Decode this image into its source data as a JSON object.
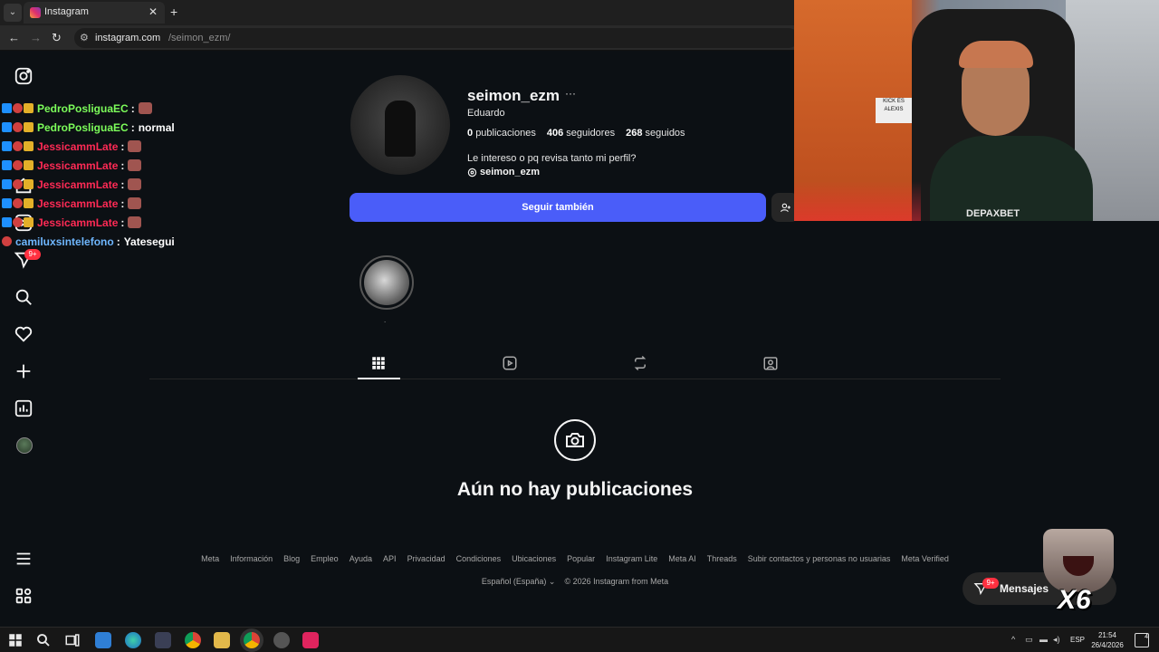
{
  "browser": {
    "tab_title": "Instagram",
    "tab_close": "✕",
    "new_tab": "+",
    "url_host": "instagram.com",
    "url_path": "/seimon_ezm/"
  },
  "chat": [
    {
      "user": "PedroPosliguaEC",
      "color": "#7cfc5a",
      "message": ""
    },
    {
      "user": "PedroPosliguaEC",
      "color": "#7cfc5a",
      "message": "normal"
    },
    {
      "user": "JessicammLate",
      "color": "#ff2a55",
      "message": ""
    },
    {
      "user": "JessicammLate",
      "color": "#ff2a55",
      "message": ""
    },
    {
      "user": "JessicammLate",
      "color": "#ff2a55",
      "message": ""
    },
    {
      "user": "JessicammLate",
      "color": "#ff2a55",
      "message": ""
    },
    {
      "user": "JessicammLate",
      "color": "#ff2a55",
      "message": ""
    },
    {
      "user": "camiluxsintelefono",
      "color": "#6fb7ff",
      "message": "Yatesegui"
    }
  ],
  "nav": {
    "notifications_badge": "9+"
  },
  "profile": {
    "username": "seimon_ezm",
    "more": "···",
    "full_name": "Eduardo",
    "posts_count": "0",
    "posts_label": "publicaciones",
    "followers_count": "406",
    "followers_label": "seguidores",
    "following_count": "268",
    "following_label": "seguidos",
    "bio": "Le intereso o pq revisa tanto mi perfil?",
    "threads_handle": "seimon_ezm",
    "follow_button": "Seguir también",
    "highlight_label": "."
  },
  "empty_state": {
    "title": "Aún no hay publicaciones"
  },
  "footer": {
    "links": [
      "Meta",
      "Información",
      "Blog",
      "Empleo",
      "Ayuda",
      "API",
      "Privacidad",
      "Condiciones",
      "Ubicaciones",
      "Popular",
      "Instagram Lite",
      "Meta AI",
      "Threads",
      "Subir contactos y personas no usuarias",
      "Meta Verified"
    ],
    "language": "Español (España)",
    "copyright": "© 2026 Instagram from Meta"
  },
  "messages": {
    "label": "Mensajes",
    "badge": "9+"
  },
  "webcam": {
    "sign_text": "KICK ES ALEXIS",
    "shirt_text": "DEPAXBET"
  },
  "emote": {
    "multiplier": "X6"
  },
  "taskbar": {
    "language": "ESP",
    "time": "21:54",
    "date": "26/4/2026",
    "notifications": "4"
  }
}
